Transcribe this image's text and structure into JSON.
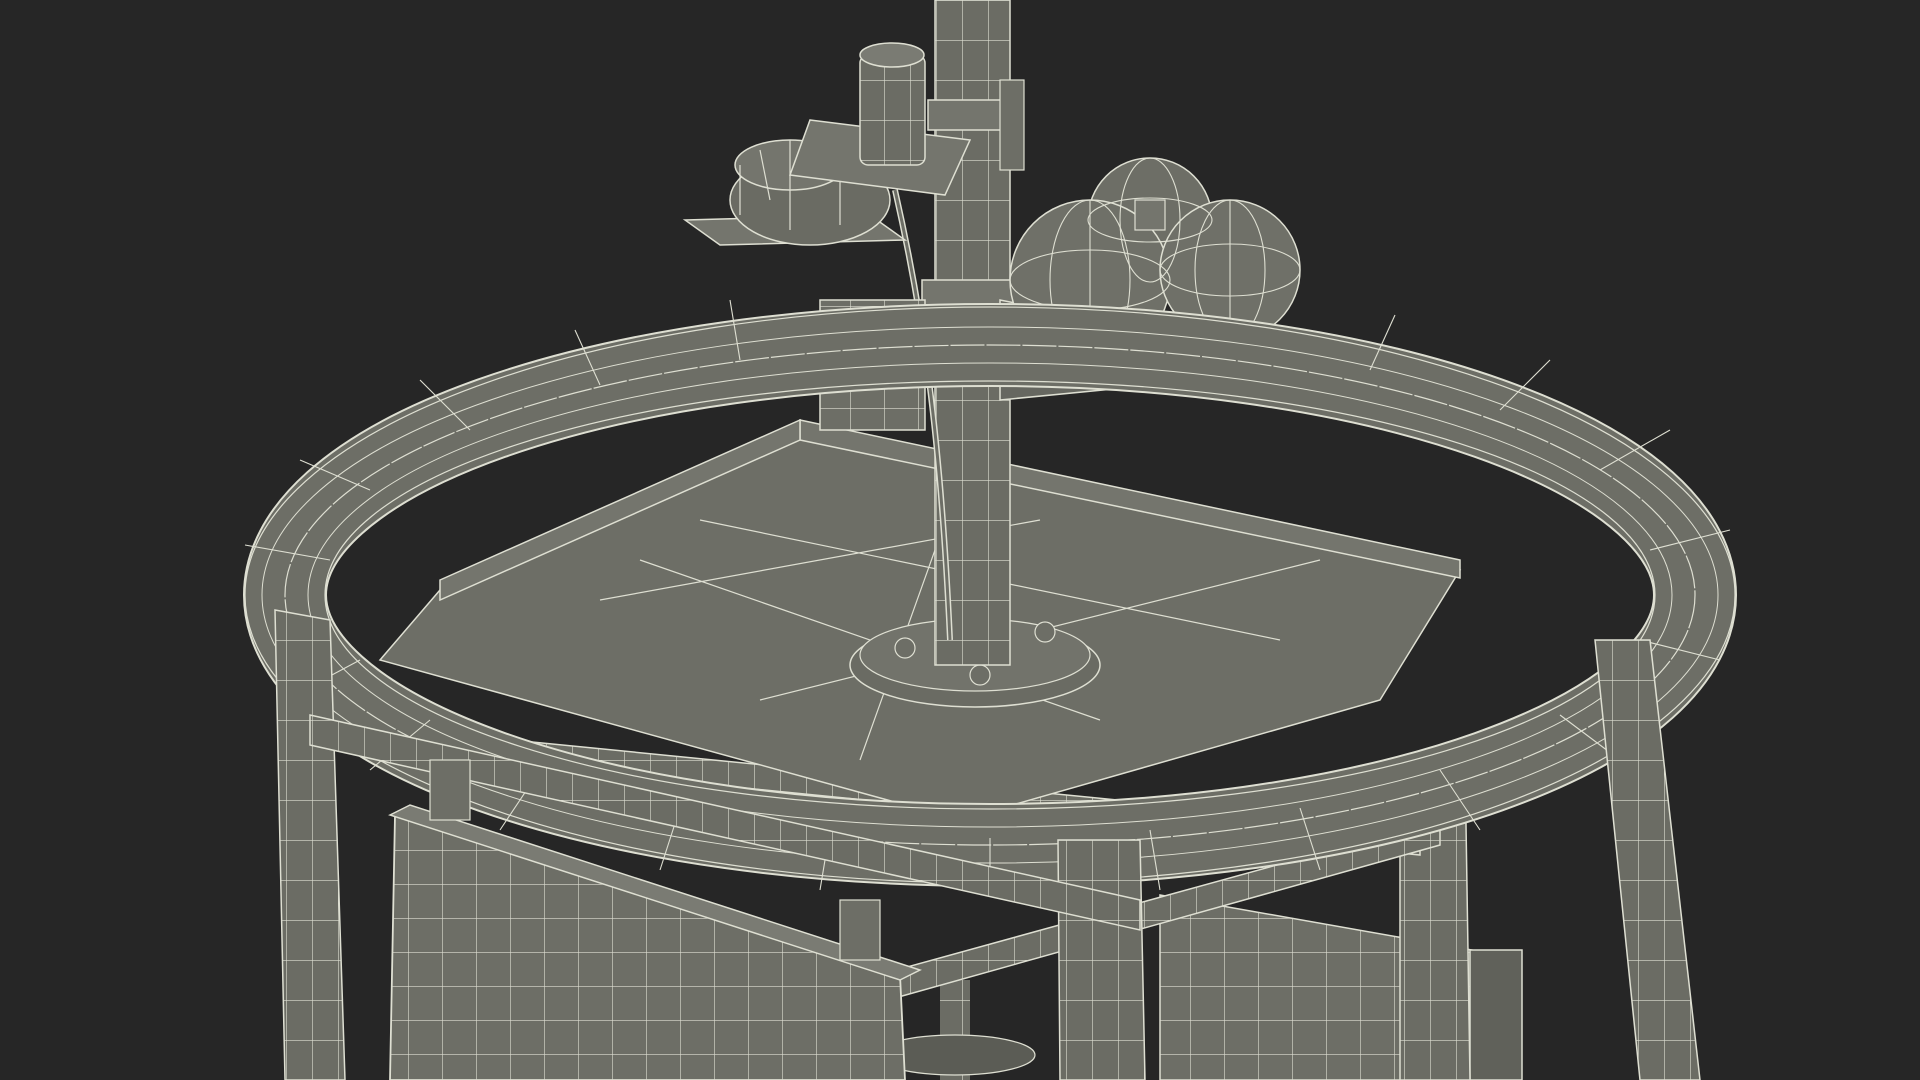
{
  "scene": {
    "subject": "wireframe-3d-model",
    "background_color": "#262626",
    "mesh_fill_color": "#6d6e66",
    "mesh_fill_dark": "#55564f",
    "wire_color": "#e6e6da"
  }
}
